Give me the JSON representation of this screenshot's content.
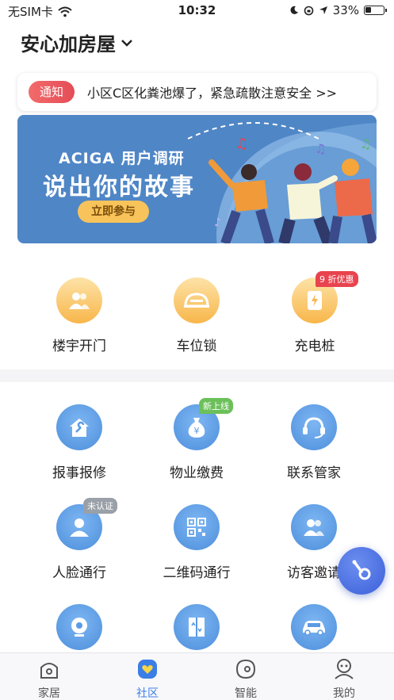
{
  "status_bar": {
    "carrier": "无SIM卡",
    "time": "10:32",
    "battery": "33%",
    "battery_level": 0.33
  },
  "header": {
    "home_name": "安心加房屋"
  },
  "notice": {
    "tag": "通知",
    "text": "小区C区化粪池爆了，紧急疏散注意安全 >>"
  },
  "banner": {
    "subtitle": "ACIGA 用户调研",
    "title": "说出你的故事",
    "button": "立即参与"
  },
  "quick_actions": [
    {
      "label": "楼宇开门",
      "icon": "users-icon"
    },
    {
      "label": "车位锁",
      "icon": "parking-lock-icon"
    },
    {
      "label": "充电桩",
      "icon": "charger-icon",
      "badge": "9 折优惠"
    }
  ],
  "services": [
    {
      "label": "报事报修",
      "icon": "repair-house-icon"
    },
    {
      "label": "物业缴费",
      "icon": "money-bag-icon",
      "badge": "新上线"
    },
    {
      "label": "联系管家",
      "icon": "headset-icon"
    },
    {
      "label": "人脸通行",
      "icon": "face-user-icon",
      "badge": "未认证"
    },
    {
      "label": "二维码通行",
      "icon": "qr-code-icon"
    },
    {
      "label": "访客邀请",
      "icon": "visitors-icon"
    },
    {
      "label": "",
      "icon": "camera-icon"
    },
    {
      "label": "",
      "icon": "elevator-icon"
    },
    {
      "label": "",
      "icon": "car-icon"
    }
  ],
  "tabs": [
    {
      "label": "家居",
      "icon": "home-icon",
      "active": false
    },
    {
      "label": "社区",
      "icon": "community-icon",
      "active": true
    },
    {
      "label": "智能",
      "icon": "smart-icon",
      "active": false
    },
    {
      "label": "我的",
      "icon": "profile-icon",
      "active": false
    }
  ],
  "colors": {
    "accent": "#3b7ee6",
    "service_blue": "#5b9ae4",
    "quick_orange": "#f8b64a",
    "notice_red": "#e44d57"
  }
}
